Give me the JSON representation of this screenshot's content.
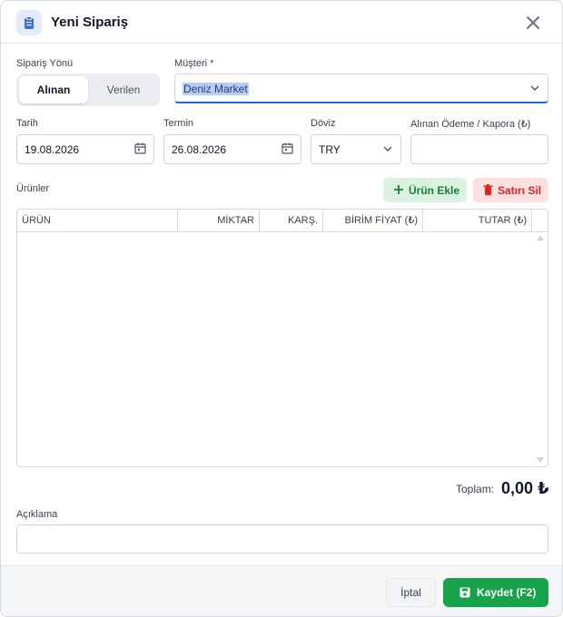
{
  "dialog": {
    "title": "Yeni Sipariş",
    "icon": "clipboard-icon"
  },
  "order_direction": {
    "label": "Sipariş Yönü",
    "options": [
      "Alınan",
      "Verilen"
    ],
    "selected": "Alınan"
  },
  "customer": {
    "label": "Müşteri *",
    "value": "Deniz Market"
  },
  "date": {
    "label": "Tarih",
    "value": "19.08.2026"
  },
  "due": {
    "label": "Termin",
    "value": "26.08.2026"
  },
  "currency": {
    "label": "Döviz",
    "value": "TRY"
  },
  "payment": {
    "label": "Alınan Ödeme / Kapora (₺)",
    "value": ""
  },
  "products": {
    "label": "Ürünler",
    "add_label": "Ürün Ekle",
    "delete_label": "Satırı Sil",
    "columns": [
      "ÜRÜN",
      "MİKTAR",
      "KARŞ.",
      "BİRİM FİYAT (₺)",
      "TUTAR (₺)"
    ],
    "rows": []
  },
  "total": {
    "label": "Toplam:",
    "value": "0,00 ₺"
  },
  "note": {
    "label": "Açıklama",
    "value": ""
  },
  "footer": {
    "cancel_label": "İptal",
    "save_label": "Kaydet (F2)"
  },
  "colors": {
    "accent": "#2563eb",
    "success": "#16a34a",
    "danger": "#dc2626"
  }
}
